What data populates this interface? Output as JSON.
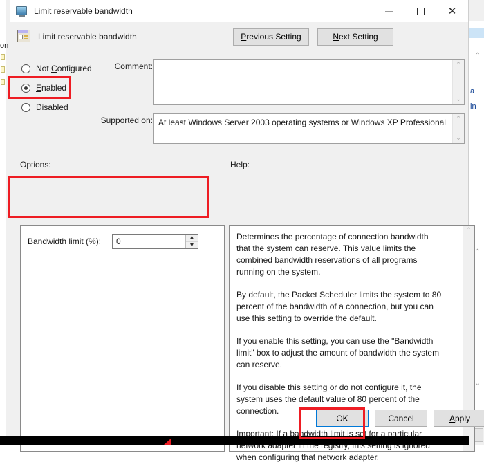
{
  "window": {
    "title": "Limit reservable bandwidth",
    "title_icon": "monitor-icon",
    "minimize_label": "—",
    "maximize_label": "☐",
    "close_label": "✕"
  },
  "header": {
    "policy_icon": "policy-setting-icon",
    "policy_name": "Limit reservable bandwidth",
    "previous_setting": "Previous Setting",
    "previous_setting_pre": "P",
    "previous_setting_post": "revious Setting",
    "next_setting": "Next Setting",
    "next_setting_pre": "N",
    "next_setting_post": "ext Setting"
  },
  "state_options": [
    {
      "label": "Not Configured",
      "mnemonic_pre": "Not ",
      "mnemonic": "C",
      "mnemonic_post": "onfigured",
      "selected": false
    },
    {
      "label": "Enabled",
      "mnemonic_pre": "",
      "mnemonic": "E",
      "mnemonic_post": "nabled",
      "selected": true
    },
    {
      "label": "Disabled",
      "mnemonic_pre": "",
      "mnemonic": "D",
      "mnemonic_post": "isabled",
      "selected": false
    }
  ],
  "comment": {
    "label": "Comment:",
    "value": "",
    "scroll_up": "⌃",
    "scroll_down": "⌄"
  },
  "supported_on": {
    "label": "Supported on:",
    "value": "At least Windows Server 2003 operating systems or Windows XP Professional",
    "scroll_up": "⌃",
    "scroll_down": "⌄"
  },
  "options": {
    "label": "Options:",
    "bandwidth_label": "Bandwidth limit (%):",
    "bandwidth_value": "0",
    "spin_up": "▲",
    "spin_down": "▼"
  },
  "help": {
    "label": "Help:",
    "paragraphs": [
      "Determines the percentage of connection bandwidth that the system can reserve. This value limits the combined bandwidth reservations of all programs running on the system.",
      "By default, the Packet Scheduler limits the system to 80 percent of the bandwidth of a connection, but you can use this setting to override the default.",
      "If you enable this setting, you can use the \"Bandwidth limit\" box to adjust the amount of bandwidth the system can reserve.",
      "If you disable this setting or do not configure it, the system uses the default value of 80 percent of the connection.",
      "Important: If a bandwidth limit is set for a particular network adapter in the registry, this setting is ignored when configuring that network adapter."
    ],
    "scroll_up": "⌃"
  },
  "footer": {
    "ok": "OK",
    "cancel": "Cancel",
    "apply": "Apply",
    "apply_pre": "A",
    "apply_post": "pply"
  },
  "annotations": {
    "accent_color": "#ee1c23",
    "focus_color": "#0078d7",
    "highlight_enabled": "Enabled",
    "highlight_options": "Bandwidth limit (%)",
    "highlight_ok": "OK"
  },
  "background": {
    "left_text": "on",
    "right_word_1": "a",
    "right_word_2": "in"
  }
}
